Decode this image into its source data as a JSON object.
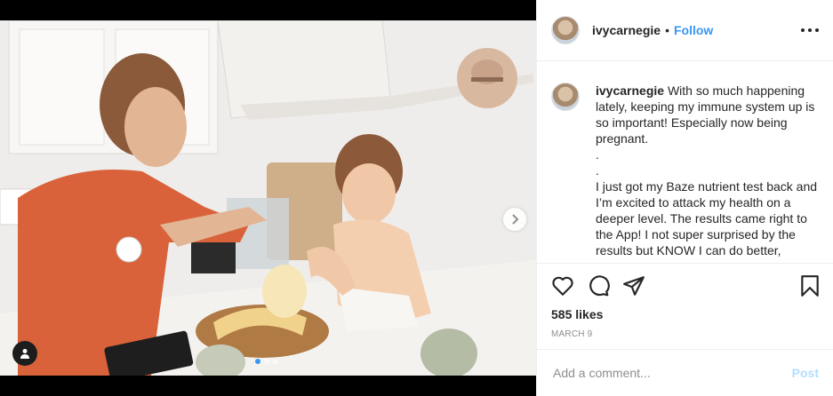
{
  "header": {
    "username": "ivycarnegie",
    "separator": "•",
    "follow_label": "Follow"
  },
  "caption": {
    "username": "ivycarnegie",
    "lines": [
      "With so much happening lately, keeping my immune system up is so important! Especially now being pregnant.",
      ".",
      ".",
      "I just got my Baze nutrient test back and I’m excited to attack my health on a deeper level. The results came right to the App! I not super surprised by the results but KNOW I can do better,"
    ]
  },
  "engagement": {
    "likes": "585 likes",
    "date": "MARCH 9"
  },
  "comment": {
    "placeholder": "Add a comment...",
    "post_label": "Post"
  },
  "carousel": {
    "slide_count": 3,
    "active_index": 0
  },
  "colors": {
    "follow_blue": "#3897f0",
    "post_disabled": "#b2dffc",
    "text": "#262626",
    "muted": "#8e8e8e",
    "border": "#efefef"
  },
  "icons": [
    "user-tag-icon",
    "chevron-right-icon",
    "heart-icon",
    "comment-icon",
    "share-icon",
    "bookmark-icon",
    "more-options-icon"
  ]
}
